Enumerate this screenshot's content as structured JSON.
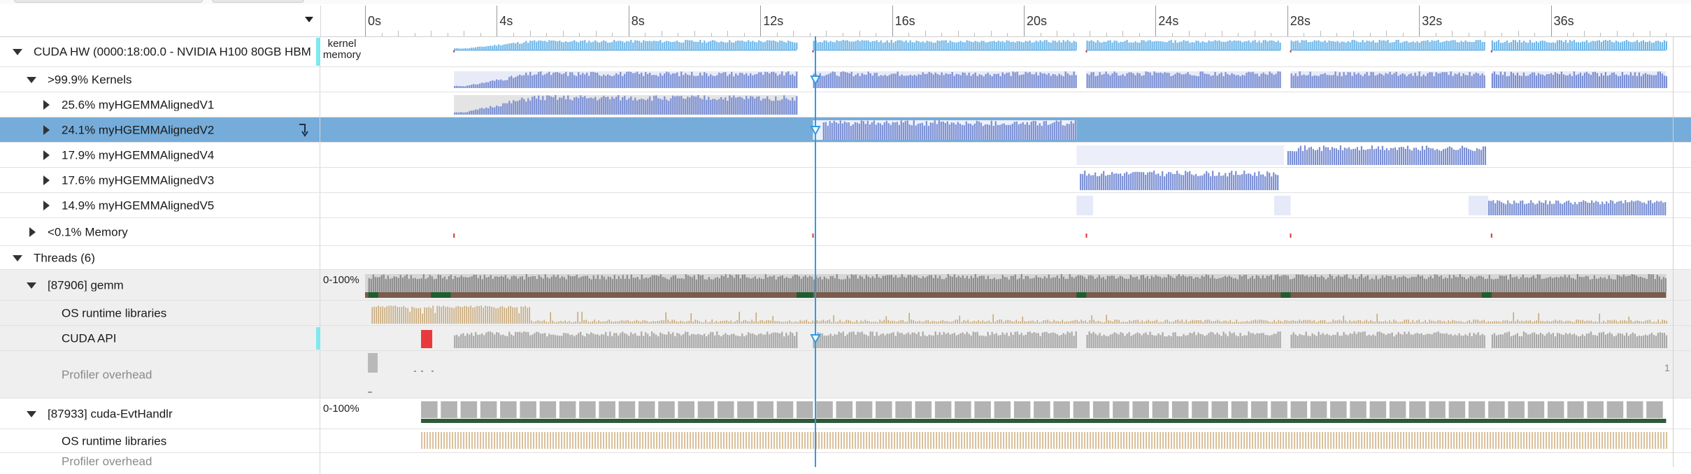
{
  "timeline": {
    "ticks": [
      "0s",
      "4s",
      "8s",
      "12s",
      "16s",
      "20s",
      "24s",
      "28s",
      "32s",
      "36s"
    ],
    "cursor_time_s": 13.6
  },
  "rows": {
    "gpu": {
      "label": "CUDA HW (0000:18:00.0 - NVIDIA H100 80GB HBM",
      "sub1": "kernel",
      "sub2": "memory"
    },
    "kernels": {
      "label": ">99.9% Kernels"
    },
    "k1": {
      "label": "25.6% myHGEMMAlignedV1"
    },
    "k2": {
      "label": "24.1% myHGEMMAlignedV2"
    },
    "k4": {
      "label": "17.9% myHGEMMAlignedV4"
    },
    "k3": {
      "label": "17.6% myHGEMMAlignedV3"
    },
    "k5": {
      "label": "14.9% myHGEMMAlignedV5"
    },
    "memory": {
      "label": "<0.1% Memory"
    },
    "threads": {
      "label": "Threads (6)"
    },
    "gemm": {
      "label": "[87906] gemm",
      "scale": "0-100%"
    },
    "osrt": {
      "label": "OS runtime libraries"
    },
    "cudaapi": {
      "label": "CUDA API"
    },
    "profiler": {
      "label": "Profiler overhead",
      "end_mark": "1"
    },
    "evt": {
      "label": "[87933] cuda-EvtHandlr",
      "scale": "0-100%"
    },
    "osrt2": {
      "label": "OS runtime libraries"
    },
    "profiler2": {
      "label": "Profiler overhead"
    }
  },
  "colors": {
    "kernel_blue": "#7a8fd4",
    "hw_blue": "#6fb6e8",
    "cursor": "#2e9be6",
    "thread_grey": "#8c8c8c",
    "osrt_tan": "#c9a878",
    "api_grey": "#a8a8a8",
    "api_red": "#e8393c",
    "green": "#1e5e2e",
    "selected": "#76acd9"
  }
}
